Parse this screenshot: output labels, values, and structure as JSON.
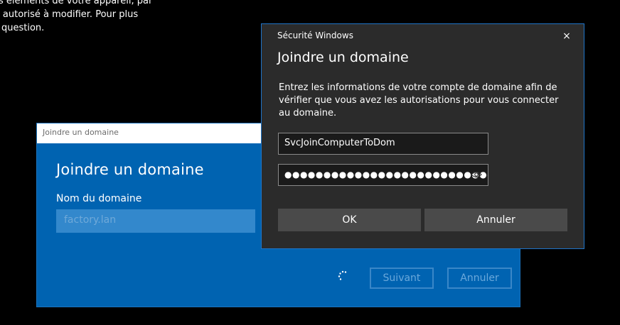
{
  "background": {
    "lines": [
      "Les éléments de votre appareil, par",
      "es autorisé à modifier. Pour plus",
      "question."
    ]
  },
  "join_dialog": {
    "title": "Joindre un domaine",
    "heading": "Joindre un domaine",
    "domain_label": "Nom du domaine",
    "domain_value": "factory.lan",
    "next_label": "Suivant",
    "cancel_label": "Annuler"
  },
  "security_dialog": {
    "title": "Sécurité Windows",
    "heading": "Joindre un domaine",
    "description": "Entrez les informations de votre compte de domaine afin de vérifier que vous avez les autorisations pour vous connecter au domaine.",
    "username_value": "SvcJoinComputerToDom",
    "password_mask": "●●●●●●●●●●●●●●●●●●●●●●●●●●●",
    "ok_label": "OK",
    "cancel_label": "Annuler",
    "close_icon": "×"
  },
  "colors": {
    "accent": "#0063b1",
    "security_border": "#1f74c8",
    "security_bg": "#2b2b2b"
  },
  "icons": {
    "spinner": "loading-spinner-icon",
    "reveal": "eye-reveal-icon",
    "close": "close-icon"
  }
}
